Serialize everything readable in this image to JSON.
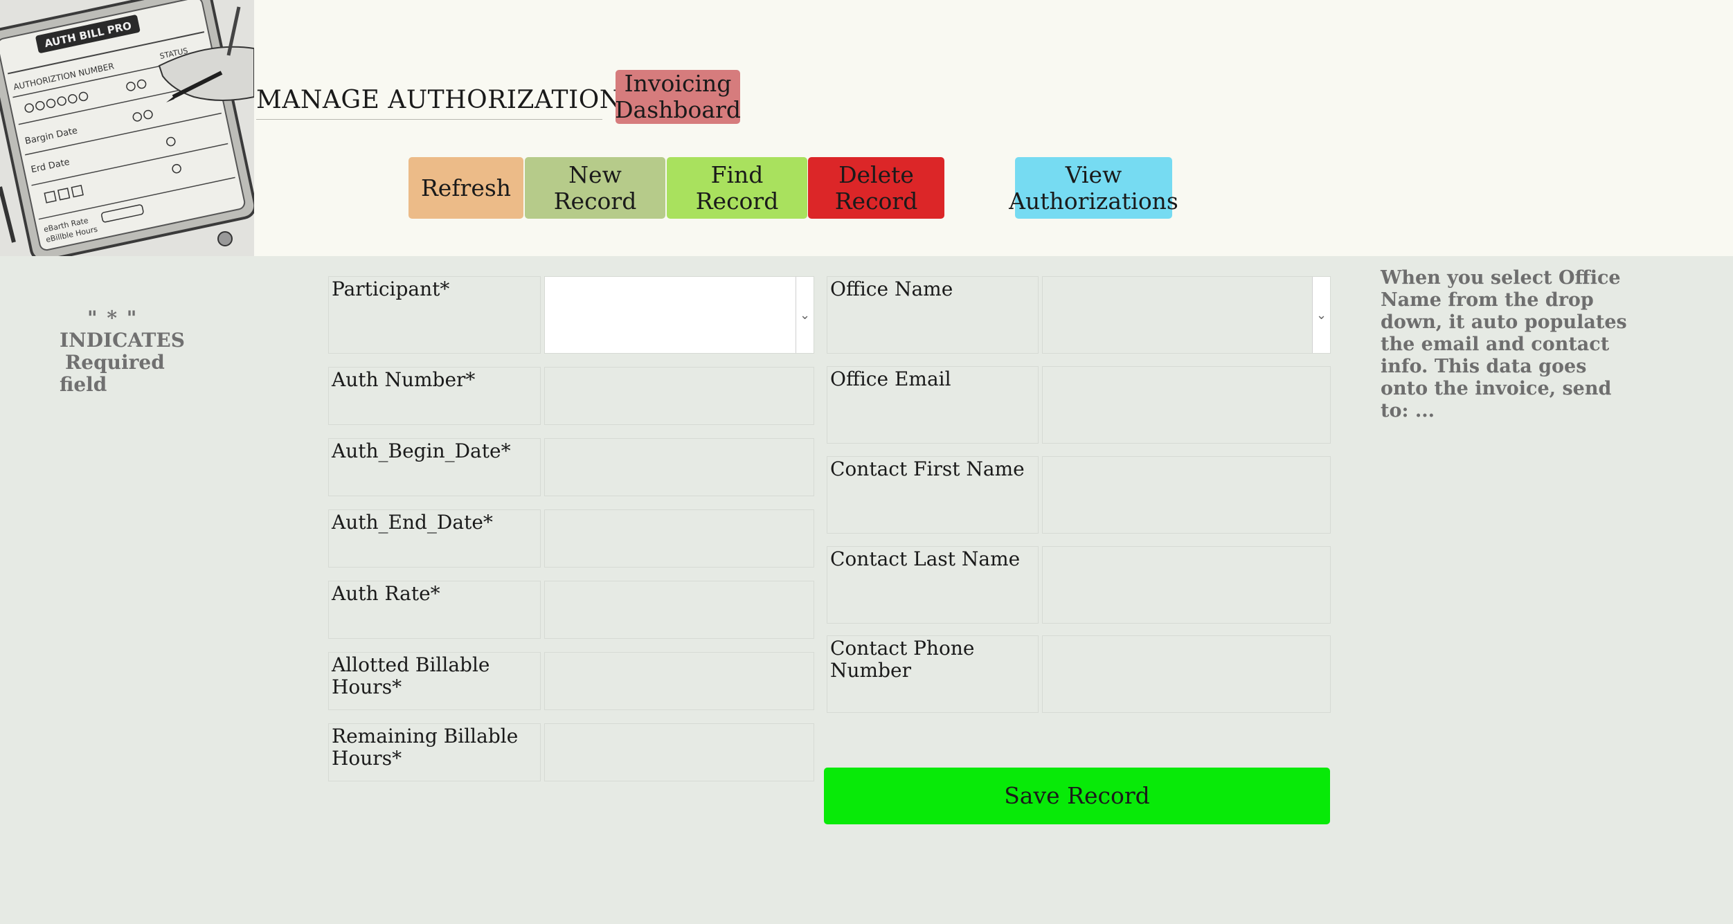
{
  "header": {
    "logo_alt": "AUTH BILL PRO",
    "title": "MANAGE AUTHORIZATIONS",
    "dashboard_button": [
      "Invoicing",
      "Dashboard"
    ]
  },
  "toolbar": {
    "refresh": "Refresh",
    "new_record": "New Record",
    "find_record": "Find Record",
    "delete_record": [
      "Delete",
      "Record"
    ],
    "view_authorizations": [
      "View",
      "Authorizations"
    ]
  },
  "required_note": {
    "symbol": "\" * \"",
    "line1": "INDICATES",
    "line2": "Required",
    "line3": "field"
  },
  "form_left": {
    "participant": "Participant*",
    "participant_value": "",
    "auth_number": "Auth Number*",
    "auth_begin_date": "Auth_Begin_Date*",
    "auth_end_date": "Auth_End_Date*",
    "auth_rate": "Auth Rate*",
    "allotted_hours": "Allotted Billable Hours*",
    "remaining_hours": [
      "Remaining Billable",
      "Hours*"
    ]
  },
  "form_right": {
    "office_name": "Office Name",
    "office_email": "Office Email",
    "contact_first_name": "Contact First Name",
    "contact_last_name": "Contact Last Name",
    "contact_phone": "Contact Phone Number"
  },
  "save_button": "Save Record",
  "help_text": "When you select Office Name from the drop down, it auto populates the email and contact info.  This data goes onto the invoice, send to: ...",
  "colors": {
    "page_bg": "#e6eae4",
    "header_bg": "#f9f9f2",
    "dashboard": "#d67c7d",
    "refresh": "#ecbb88",
    "new_record": "#b6cb8a",
    "find_record": "#a9e15e",
    "delete_record": "#dc2628",
    "view_authorizations": "#76dbf2",
    "save_record": "#08ea08"
  }
}
